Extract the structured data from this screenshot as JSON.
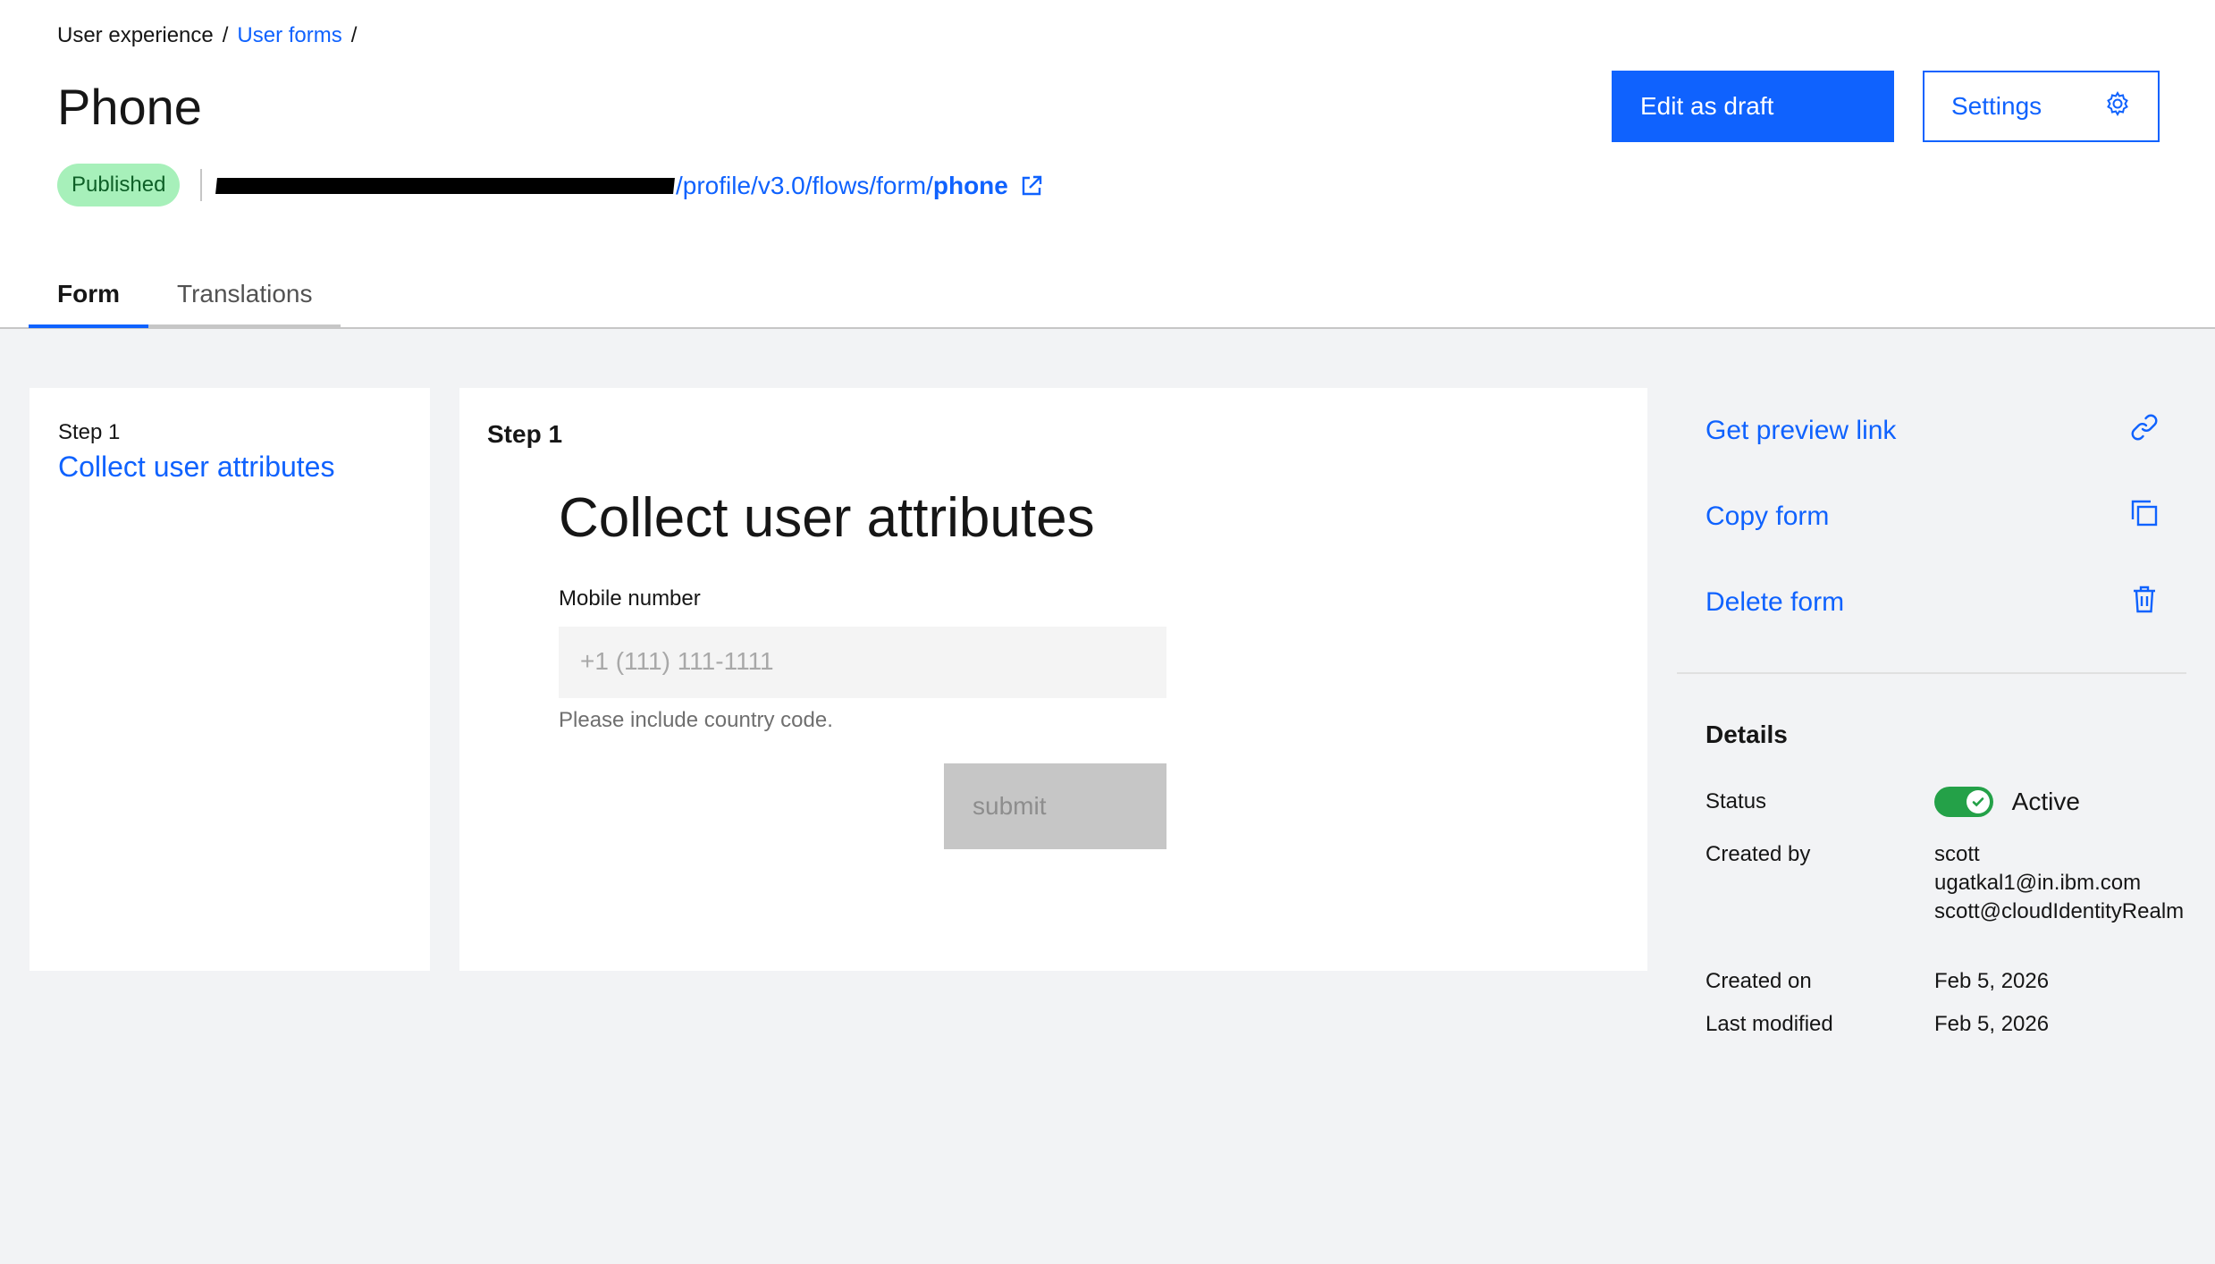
{
  "breadcrumb": {
    "root": "User experience",
    "separator1": "/",
    "parent": "User forms",
    "separator2": "/"
  },
  "page_title": "Phone",
  "status_tag": "Published",
  "url": {
    "path": "/profile/v3.0/flows/form/",
    "name": "phone"
  },
  "buttons": {
    "edit_draft": "Edit as draft",
    "settings": "Settings"
  },
  "tabs": [
    {
      "label": "Form",
      "active": true
    },
    {
      "label": "Translations",
      "active": false
    }
  ],
  "left_panel": {
    "step_label": "Step 1",
    "step_title": "Collect user attributes"
  },
  "center_panel": {
    "step_label": "Step 1",
    "form_title": "Collect user attributes",
    "field_label": "Mobile number",
    "field_placeholder": "+1 (111) 111-1111",
    "field_value": "",
    "helper_text": "Please include country code.",
    "submit_label": "submit"
  },
  "actions": [
    {
      "label": "Get preview link",
      "icon": "link-icon"
    },
    {
      "label": "Copy form",
      "icon": "copy-icon"
    },
    {
      "label": "Delete form",
      "icon": "trash-icon"
    }
  ],
  "details": {
    "title": "Details",
    "status_key": "Status",
    "status_value": "Active",
    "created_by_key": "Created by",
    "created_by_lines": [
      "scott",
      "ugatkal1@in.ibm.com",
      "scott@cloudIdentityRealm"
    ],
    "created_on_key": "Created on",
    "created_on_value": "Feb 5, 2026",
    "last_modified_key": "Last modified",
    "last_modified_value": "Feb 5, 2026"
  },
  "colors": {
    "accent": "#0f62fe",
    "status_tag_bg": "#a7f0ba",
    "toggle_on": "#24a148"
  }
}
